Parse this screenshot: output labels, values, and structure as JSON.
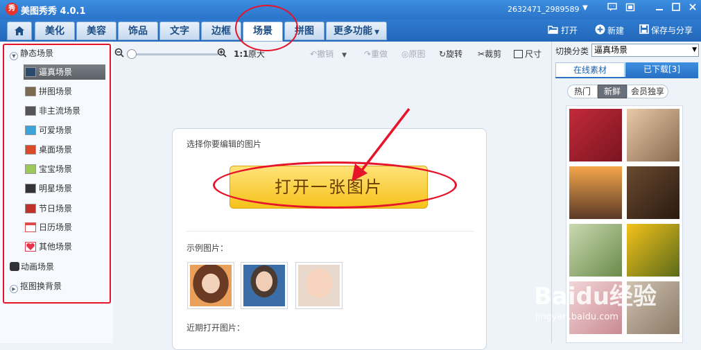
{
  "window": {
    "logo_text": "秀",
    "app_title": "美图秀秀 4.0.1",
    "user_id": "2632471_2989589"
  },
  "tabs": [
    {
      "label": "美化"
    },
    {
      "label": "美容"
    },
    {
      "label": "饰品"
    },
    {
      "label": "文字"
    },
    {
      "label": "边框"
    },
    {
      "label": "场景",
      "active": true
    },
    {
      "label": "拼图"
    },
    {
      "label": "更多功能"
    }
  ],
  "header_actions": {
    "open_label": "打开",
    "new_label": "新建",
    "save_label": "保存与分享"
  },
  "sidebar": {
    "static_group": "静态场景",
    "items": [
      {
        "label": "逼真场景",
        "active": true,
        "thumb_color": "#2b4a6e"
      },
      {
        "label": "拼图场景",
        "thumb_color": "#7a6a50"
      },
      {
        "label": "非主流场景",
        "thumb_color": "#555"
      },
      {
        "label": "可爱场景",
        "thumb_color": "#3aa3d8"
      },
      {
        "label": "桌面场景",
        "thumb_color": "#d84a2a"
      },
      {
        "label": "宝宝场景",
        "thumb_color": "#9cc75a"
      },
      {
        "label": "明星场景",
        "thumb_color": "#333"
      },
      {
        "label": "节日场景",
        "thumb_color": "#c0302a"
      },
      {
        "label": "日历场景",
        "thumb_color": "#e04a4a"
      },
      {
        "label": "其他场景",
        "thumb_color": "#e8334a"
      }
    ],
    "animated_group": "动画场景",
    "cutout_group": "抠图换背景"
  },
  "toolbar": {
    "ratio_label": "1:1",
    "original_size_label": "原大",
    "undo_label": "撤销",
    "redo_label": "重做",
    "original_label": "原图",
    "rotate_label": "旋转",
    "crop_label": "裁剪",
    "size_label": "尺寸"
  },
  "main": {
    "card_title": "选择你要编辑的图片",
    "open_button_label": "打开一张图片",
    "example_label": "示例图片：",
    "recent_label": "近期打开图片："
  },
  "right_panel": {
    "category_label": "切换分类",
    "category_value": "逼真场景",
    "tab_online": "在线素材",
    "tab_downloaded": "已下载[3]",
    "filters": [
      {
        "label": "热门"
      },
      {
        "label": "新鲜",
        "active": true
      },
      {
        "label": "会员独享"
      }
    ],
    "scenes": [
      {
        "name": "heart-wall",
        "color1": "#c32a3a",
        "color2": "#7a1420"
      },
      {
        "name": "couple-heart",
        "color1": "#e8c9a8",
        "color2": "#8a6a4e"
      },
      {
        "name": "sunset-hands",
        "color1": "#f4a64a",
        "color2": "#5a3a28"
      },
      {
        "name": "coffee-beans",
        "color1": "#6a4a30",
        "color2": "#2a1a10"
      },
      {
        "name": "white-flowers",
        "color1": "#c9d9b0",
        "color2": "#6a8a4a"
      },
      {
        "name": "sunflowers",
        "color1": "#f4c21a",
        "color2": "#5a6a1a"
      },
      {
        "name": "pink-bottom",
        "color1": "#f2d6d8",
        "color2": "#c98a92"
      },
      {
        "name": "brown-bottom",
        "color1": "#cfc2b0",
        "color2": "#8a7a66"
      }
    ]
  },
  "watermark": {
    "text": "Baidu经验",
    "sub": "jingyan.baidu.com"
  }
}
